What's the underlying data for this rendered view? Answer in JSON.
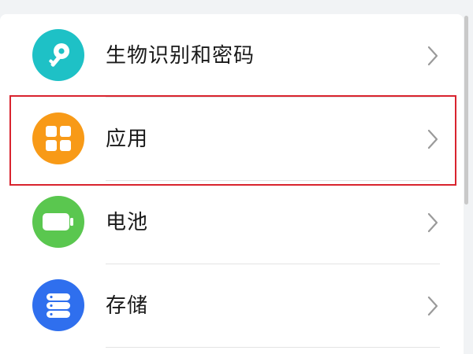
{
  "settings": {
    "items": [
      {
        "label": "生物识别和密码",
        "icon": "key-icon",
        "color": "#1ec1c6"
      },
      {
        "label": "应用",
        "icon": "apps-grid-icon",
        "color": "#f89a17"
      },
      {
        "label": "电池",
        "icon": "battery-icon",
        "color": "#5ac74f"
      },
      {
        "label": "存储",
        "icon": "storage-icon",
        "color": "#2f6fee"
      },
      {
        "label": "",
        "icon": "",
        "color": "#ffffff"
      }
    ],
    "highlight_color": "#d9232e"
  }
}
